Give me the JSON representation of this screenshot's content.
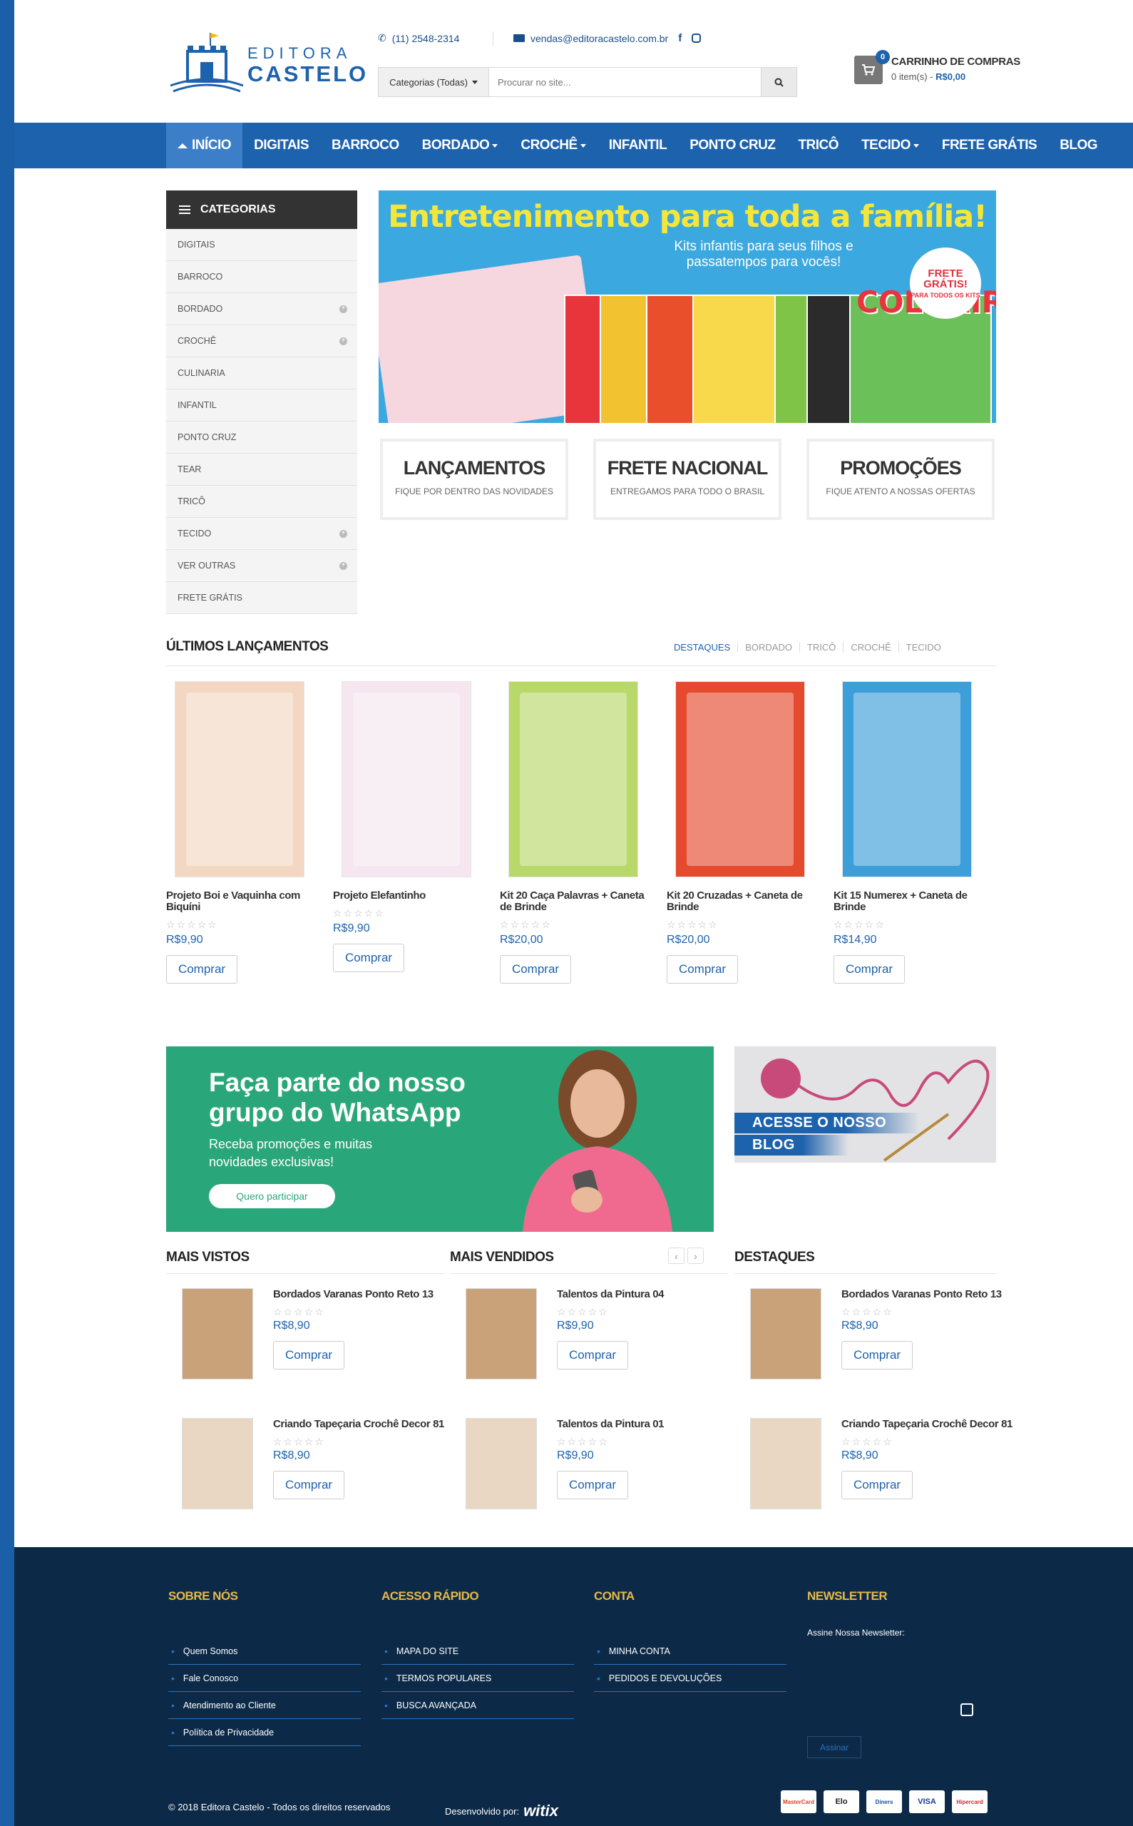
{
  "header": {
    "logo_line1": "EDITORA",
    "logo_line2": "CASTELO",
    "phone": "(11) 2548-2314",
    "email": "vendas@editoracastelo.com.br",
    "search_category": "Categorias (Todas)",
    "search_placeholder": "Procurar no site...",
    "cart_count": "0",
    "cart_title": "CARRINHO DE COMPRAS",
    "cart_items": "0 item(s) - ",
    "cart_total": "R$0,00"
  },
  "nav": [
    {
      "label": "INÍCIO",
      "active": true,
      "dropdown": false
    },
    {
      "label": "DIGITAIS",
      "dropdown": false
    },
    {
      "label": "BARROCO",
      "dropdown": false
    },
    {
      "label": "BORDADO",
      "dropdown": true
    },
    {
      "label": "CROCHÊ",
      "dropdown": true
    },
    {
      "label": "INFANTIL",
      "dropdown": false
    },
    {
      "label": "PONTO CRUZ",
      "dropdown": false
    },
    {
      "label": "TRICÔ",
      "dropdown": false
    },
    {
      "label": "TECIDO",
      "dropdown": true
    },
    {
      "label": "FRETE GRÁTIS",
      "dropdown": false
    },
    {
      "label": "BLOG",
      "dropdown": false
    }
  ],
  "sidebar": {
    "title": "CATEGORIAS",
    "items": [
      {
        "label": "DIGITAIS",
        "expand": false
      },
      {
        "label": "BARROCO",
        "expand": false
      },
      {
        "label": "BORDADO",
        "expand": true
      },
      {
        "label": "CROCHÊ",
        "expand": true
      },
      {
        "label": "CULINARIA",
        "expand": false
      },
      {
        "label": "INFANTIL",
        "expand": false
      },
      {
        "label": "PONTO CRUZ",
        "expand": false
      },
      {
        "label": "TEAR",
        "expand": false
      },
      {
        "label": "TRICÔ",
        "expand": false
      },
      {
        "label": "TECIDO",
        "expand": true
      },
      {
        "label": "VER OUTRAS",
        "expand": true
      },
      {
        "label": "FRETE GRÁTIS",
        "expand": false
      }
    ]
  },
  "hero": {
    "title": "Entretenimento para toda a família!",
    "subtitle": "Kits infantis para seus filhos e passatempos para vocês!",
    "badge_line1": "FRETE",
    "badge_line2": "GRÁTIS!",
    "badge_small": "PARA TODOS OS KITS",
    "colorir": "COLORIR"
  },
  "features": [
    {
      "title": "LANÇAMENTOS",
      "sub": "FIQUE POR DENTRO DAS NOVIDADES"
    },
    {
      "title": "FRETE NACIONAL",
      "sub": "ENTREGAMOS PARA TODO O BRASIL"
    },
    {
      "title": "PROMOÇÕES",
      "sub": "FIQUE ATENTO A NOSSAS OFERTAS"
    }
  ],
  "latest": {
    "title": "ÚLTIMOS LANÇAMENTOS",
    "tabs": [
      "DESTAQUES",
      "BORDADO",
      "TRICÔ",
      "CROCHÊ",
      "TECIDO"
    ],
    "products": [
      {
        "name": "Projeto Boi e Vaquinha com Biquíni",
        "price": "R$9,90",
        "cover": "#f3d7c2"
      },
      {
        "name": "Projeto Elefantinho",
        "price": "R$9,90",
        "cover": "#f5e6ef"
      },
      {
        "name": "Kit 20 Caça Palavras + Caneta de Brinde",
        "price": "R$20,00",
        "cover": "#b8d86a"
      },
      {
        "name": "Kit 20 Cruzadas + Caneta de Brinde",
        "price": "R$20,00",
        "cover": "#e64a2e"
      },
      {
        "name": "Kit 15 Numerex + Caneta de Brinde",
        "price": "R$14,90",
        "cover": "#3c9fd9"
      }
    ],
    "buy_label": "Comprar",
    "stars": "☆☆☆☆☆"
  },
  "whatsapp": {
    "title": "Faça parte do nosso grupo do WhatsApp",
    "sub": "Receba promoções e muitas novidades exclusivas!",
    "button": "Quero participar"
  },
  "blog_banner": {
    "line1": "ACESSE O NOSSO",
    "line2": "BLOG"
  },
  "lists": {
    "mais_vistos": {
      "title": "MAIS VISTOS",
      "items": [
        {
          "name": "Bordados Varanas Ponto Reto 13",
          "price": "R$8,90"
        },
        {
          "name": "Criando Tapeçaria Crochê Decor 81",
          "price": "R$8,90"
        }
      ]
    },
    "mais_vendidos": {
      "title": "MAIS VENDIDOS",
      "items": [
        {
          "name": "Talentos da Pintura 04",
          "price": "R$9,90"
        },
        {
          "name": "Talentos da Pintura 01",
          "price": "R$9,90"
        }
      ]
    },
    "destaques": {
      "title": "DESTAQUES",
      "items": [
        {
          "name": "Bordados Varanas Ponto Reto 13",
          "price": "R$8,90"
        },
        {
          "name": "Criando Tapeçaria Crochê Decor 81",
          "price": "R$8,90"
        }
      ]
    }
  },
  "footer": {
    "sobre": {
      "title": "SOBRE NÓS",
      "links": [
        "Quem Somos",
        "Fale Conosco",
        "Atendimento ao Cliente",
        "Política de Privacidade"
      ]
    },
    "acesso": {
      "title": "ACESSO RÁPIDO",
      "links": [
        "MAPA DO SITE",
        "TERMOS POPULARES",
        "BUSCA AVANÇADA"
      ]
    },
    "conta": {
      "title": "CONTA",
      "links": [
        "MINHA CONTA",
        "PEDIDOS E DEVOLUÇÕES"
      ]
    },
    "newsletter": {
      "title": "NEWSLETTER",
      "label": "Assine Nossa Newsletter:",
      "button": "Assinar"
    },
    "copyright": "© 2018 Editora Castelo - Todos os direitos reservados",
    "developed": "Desenvolvido por:",
    "dev_brand": "witix",
    "cards": [
      "MasterCard",
      "Elo",
      "Diners",
      "VISA",
      "Hipercard"
    ]
  },
  "colors": {
    "primary": "#1d62ad",
    "footer": "#0c2a48",
    "accent_gold": "#e6b94a",
    "whatsapp": "#2aa77a"
  }
}
